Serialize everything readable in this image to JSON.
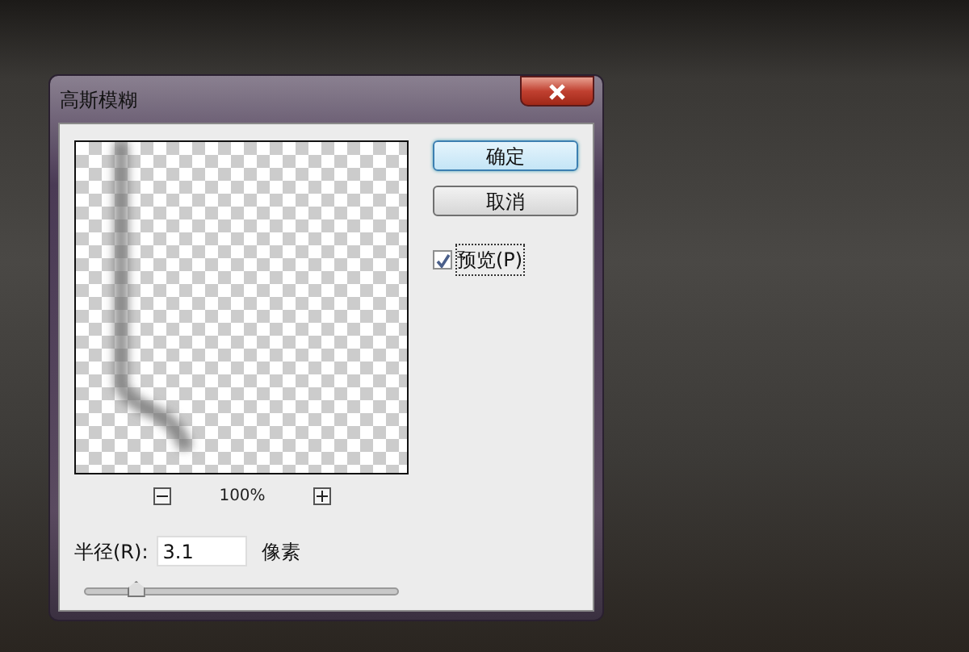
{
  "window": {
    "title": "高斯模糊"
  },
  "preview": {
    "zoom": "100%"
  },
  "buttons": [
    {
      "label": "确定",
      "default": true
    },
    {
      "label": "取消",
      "default": false
    }
  ],
  "preview_checkbox": {
    "label": "预览(P)",
    "checked": true
  },
  "radius": {
    "label": "半径(R):",
    "value": "3.1",
    "unit": "像素",
    "level": 0.16
  }
}
